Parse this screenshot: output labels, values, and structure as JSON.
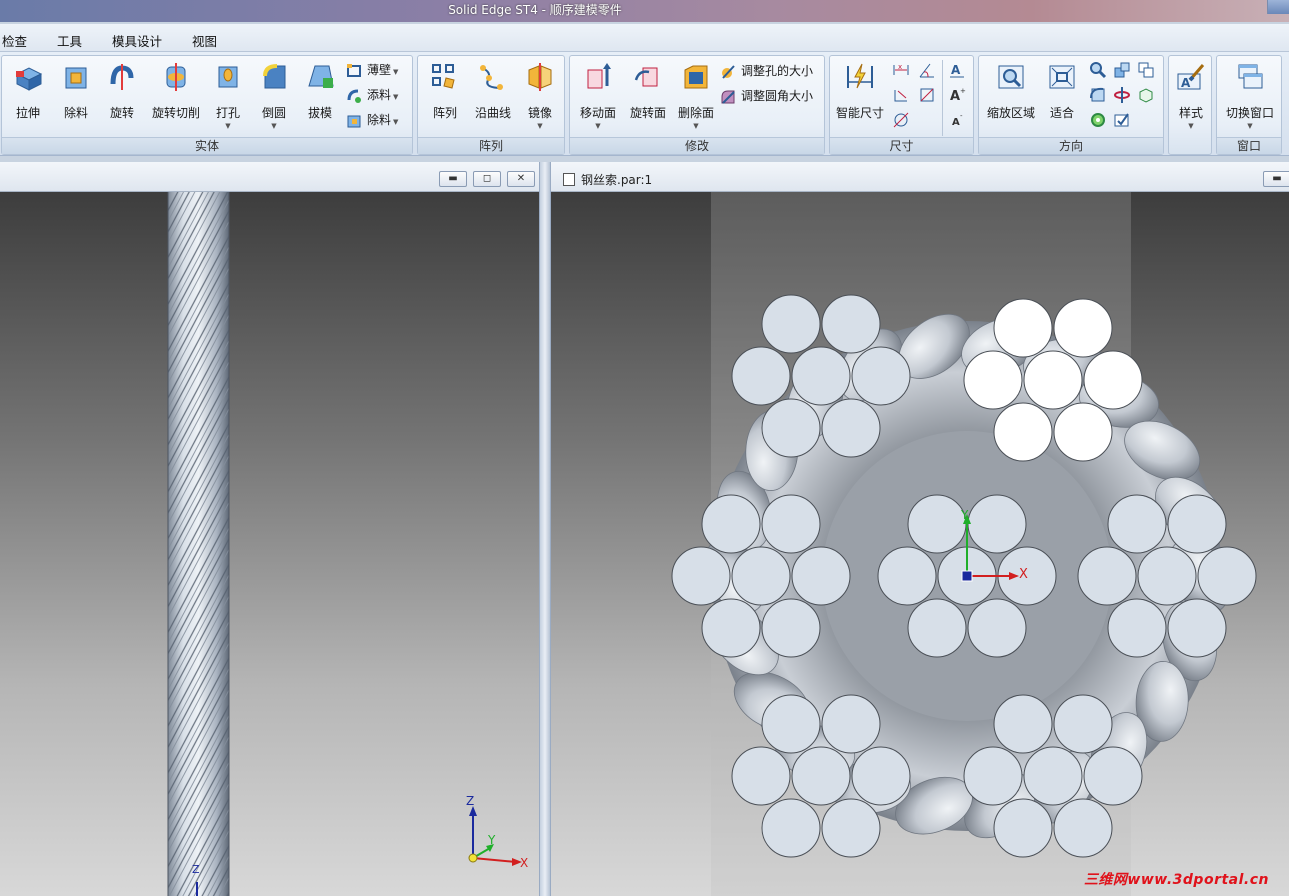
{
  "app": {
    "title": "Solid Edge ST4 - 顺序建模零件"
  },
  "menu": [
    "检查",
    "工具",
    "模具设计",
    "视图"
  ],
  "ribbon": {
    "solid": {
      "label": "实体",
      "extrude": "拉伸",
      "cut": "除料",
      "revolve": "旋转",
      "revolved_cut": "旋转切削",
      "hole": "打孔",
      "round": "倒圆",
      "draft": "拔模",
      "thin_wall": "薄壁",
      "add": "添料",
      "remove": "除料"
    },
    "pattern": {
      "label": "阵列",
      "pattern": "阵列",
      "along_curve": "沿曲线",
      "mirror": "镜像"
    },
    "modify": {
      "label": "修改",
      "move_face": "移动面",
      "rotate_face": "旋转面",
      "delete_face": "删除面",
      "resize_hole": "调整孔的大小",
      "resize_round": "调整圆角大小"
    },
    "dimension": {
      "label": "尺寸",
      "smart_dimension": "智能尺寸"
    },
    "orient": {
      "label": "方向",
      "zoom_area": "缩放区域",
      "fit": "适合"
    },
    "style": {
      "label": "样式"
    },
    "window": {
      "label": "窗口",
      "switch_window": "切换窗口"
    }
  },
  "left_pane": {
    "axis_x": "X",
    "axis_y": "Y",
    "axis_z": "Z"
  },
  "right_pane": {
    "doc_title": "钢丝索.par:1",
    "axis_x": "X",
    "axis_y": "Y"
  },
  "watermark": "三维网www.3dportal.cn"
}
